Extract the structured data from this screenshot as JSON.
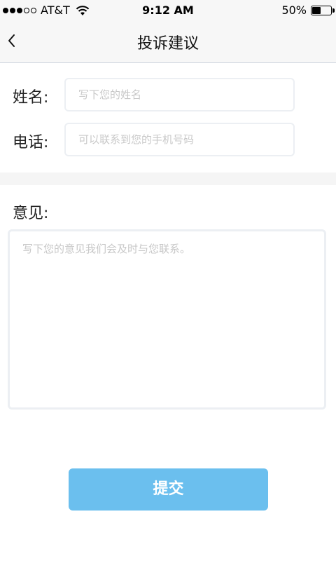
{
  "status_bar": {
    "carrier": "AT&T",
    "time": "9:12 AM",
    "battery_percent_text": "50%",
    "battery_level": 0.5,
    "signal_bars_filled": 3,
    "signal_bars_total": 5
  },
  "nav": {
    "title": "投诉建议"
  },
  "form": {
    "name_label": "姓名:",
    "name_placeholder": "写下您的姓名",
    "phone_label": "电话:",
    "phone_placeholder": "可以联系到您的手机号码",
    "opinion_label": "意见:",
    "opinion_placeholder": "写下您的意见我们会及时与您联系。"
  },
  "submit_label": "提交",
  "colors": {
    "accent": "#6bbfee",
    "bar_bg": "#f7f7f7",
    "field_border": "#eceff3",
    "placeholder": "#c8c8c8"
  }
}
